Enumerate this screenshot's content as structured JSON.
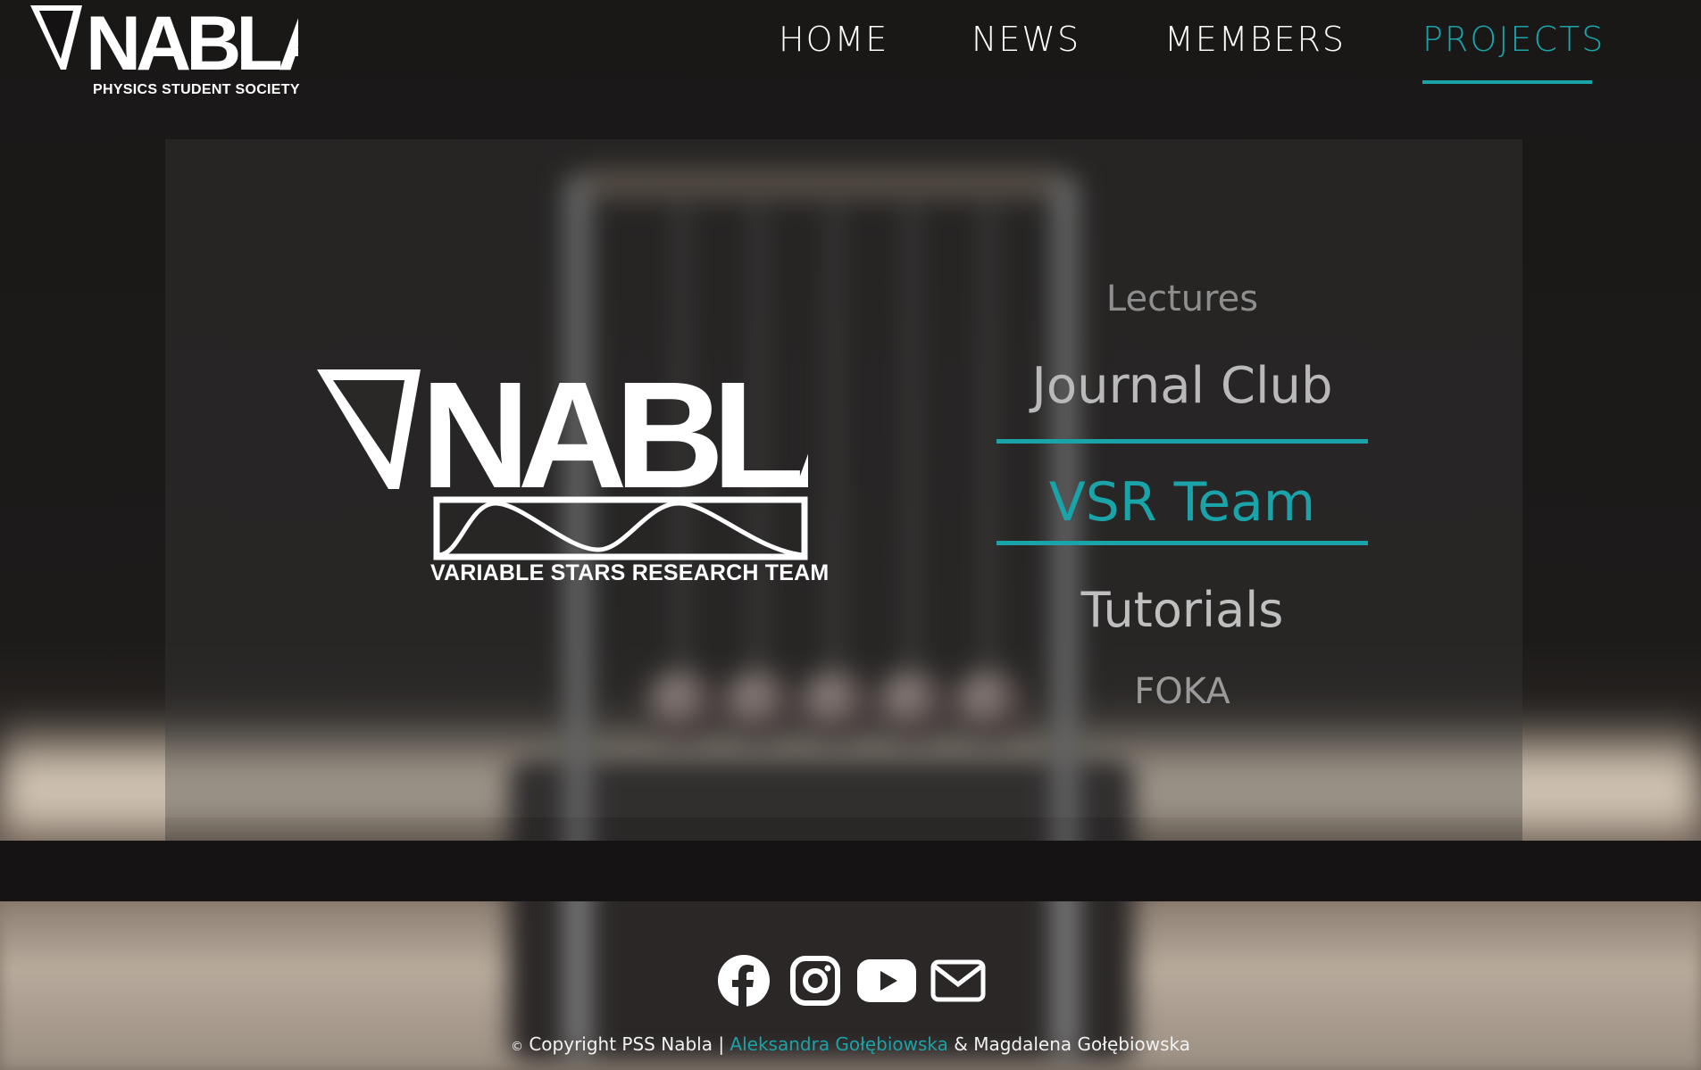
{
  "brand": {
    "logo_text": "NABLA",
    "subtitle": "PHYSICS STUDENT SOCIETY"
  },
  "nav": {
    "items": [
      {
        "label": "HOME"
      },
      {
        "label": "NEWS"
      },
      {
        "label": "MEMBERS"
      },
      {
        "label": "PROJECTS",
        "active": true
      }
    ]
  },
  "hero": {
    "logo_text": "NABLA",
    "team_label": "VARIABLE STARS RESEARCH TEAM"
  },
  "projects": {
    "items": [
      {
        "label": "Lectures"
      },
      {
        "label": "Journal Club"
      },
      {
        "label": "VSR Team",
        "selected": true
      },
      {
        "label": "Tutorials"
      },
      {
        "label": "FOKA"
      }
    ]
  },
  "footer": {
    "social_icons": [
      "facebook-icon",
      "instagram-icon",
      "youtube-icon",
      "mail-icon"
    ],
    "copyright_symbol": "©",
    "copyright_prefix": "Copyright PSS Nabla |",
    "author_link": "Aleksandra Gołębiowska",
    "author_suffix": "& Magdalena Gołębiowska"
  },
  "colors": {
    "accent": "#1aa3a8",
    "background": "#141212"
  }
}
